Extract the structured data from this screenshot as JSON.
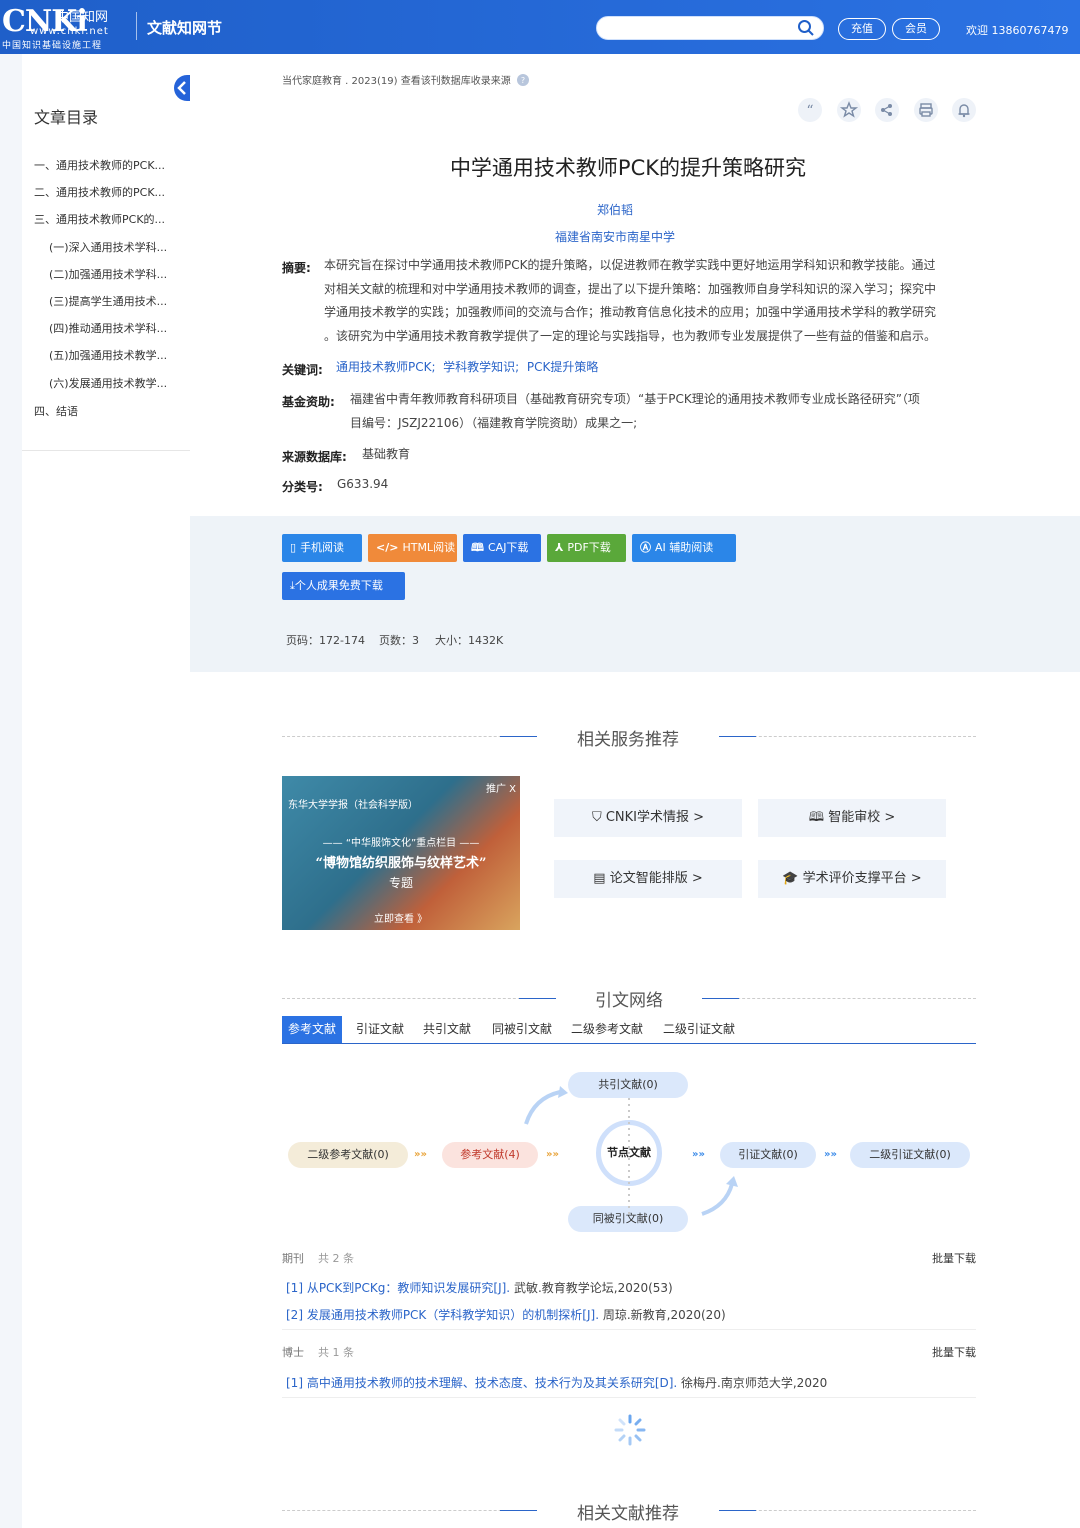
{
  "header": {
    "logo_text": "CNKi",
    "logo_cn": "中国知网",
    "logo_url": "www.cnki.net",
    "logo_sub": "中国知识基础设施工程",
    "brand2": "文献知网节",
    "search_placeholder": "",
    "recharge_label": "充值",
    "member_label": "会员",
    "welcome": "欢迎  13860767479"
  },
  "sidebar": {
    "title": "文章目录",
    "items": [
      "一、通用技术教师的PCK...",
      "二、通用技术教师的PCK...",
      "三、通用技术教师PCK的...",
      "(一)深入通用技术学科...",
      "(二)加强通用技术学科...",
      "(三)提高学生通用技术...",
      "(四)推动通用技术学科...",
      "(五)加强通用技术教学...",
      "(六)发展通用技术教学...",
      "四、结语"
    ]
  },
  "article": {
    "breadcrumb": "当代家庭教育 . 2023(19)  查看该刊数据库收录来源",
    "title": "中学通用技术教师PCK的提升策略研究",
    "author": "郑伯韬",
    "org": "福建省南安市南星中学",
    "abstract_label": "摘要:",
    "abstract_lines": [
      "本研究旨在探讨中学通用技术教师PCK的提升策略，以促进教师在教学实践中更好地运用学科知识和教学技能。通过",
      "对相关文献的梳理和对中学通用技术教师的调查，提出了以下提升策略：加强教师自身学科知识的深入学习；探究中",
      "学通用技术教学的实践；加强教师间的交流与合作；推动教育信息化技术的应用；加强中学通用技术学科的教学研究",
      "。该研究为中学通用技术教育教学提供了一定的理论与实践指导，也为教师专业发展提供了一些有益的借鉴和启示。"
    ],
    "keywords_label": "关键词:",
    "keywords": [
      "通用技术教师PCK;",
      "学科教学知识;",
      "PCK提升策略"
    ],
    "fund_label": "基金资助:",
    "fund_lines": [
      "福建省中青年教师教育科研项目（基础教育研究专项）“基于PCK理论的通用技术教师专业成长路径研究”（项",
      "目编号：JSZJ22106）（福建教育学院资助）成果之一;"
    ],
    "source_label": "来源数据库:",
    "source_value": "基础教育",
    "class_label": "分类号:",
    "class_value": "G633.94"
  },
  "downloads": {
    "mobile": "手机阅读",
    "html": "HTML阅读",
    "caj": "CAJ下载",
    "pdf": "PDF下载",
    "ai": "AI 辅助阅读",
    "personal": "个人成果免费下载",
    "pages_label": "页码：",
    "pages_value": "172-174",
    "count_label": "页数：",
    "count_value": "3",
    "size_label": "大小：",
    "size_value": "1432K"
  },
  "services": {
    "title": "相关服务推荐",
    "banner_pub": "东华大学学报（社会科学版）",
    "banner_ad": "推广 X",
    "banner_col": "——  “中华服饰文化”重点栏目  ——",
    "banner_t1": "“博物馆纺织服饰与纹样艺术”",
    "banner_t2": "专题",
    "banner_go": "立即查看 》",
    "items": [
      "CNKI学术情报 >",
      "智能审校 >",
      "论文智能排版 >",
      "学术评价支撑平台 >"
    ]
  },
  "network": {
    "title": "引文网络",
    "tabs": [
      "参考文献",
      "引证文献",
      "共引文献",
      "同被引文献",
      "二级参考文献",
      "二级引证文献"
    ],
    "nodes": {
      "co_cite": "共引文献(0)",
      "secondary_ref": "二级参考文献(0)",
      "ref": "参考文献(4)",
      "center": "节点文献",
      "cited_by": "引证文献(0)",
      "secondary_cited": "二级引证文献(0)",
      "co_cited": "同被引文献(0)"
    },
    "arrow_text": "»»"
  },
  "refs": {
    "journal_label": "期刊",
    "journal_count": "共 2 条",
    "batch": "批量下载",
    "journal_items": [
      {
        "title": "[1] 从PCK到PCKg：教师知识发展研究[J].",
        "rest": " 武敏.教育教学论坛,2020(53)"
      },
      {
        "title": "[2] 发展通用技术教师PCK（学科教学知识）的机制探析[J].",
        "rest": " 周琼.新教育,2020(20)"
      }
    ],
    "phd_label": "博士",
    "phd_count": "共 1 条",
    "phd_items": [
      {
        "title": "[1] 高中通用技术教师的技术理解、技术态度、技术行为及其关系研究[D].",
        "rest": " 徐梅丹.南京师范大学,2020"
      }
    ]
  },
  "related": {
    "title": "相关文献推荐"
  }
}
